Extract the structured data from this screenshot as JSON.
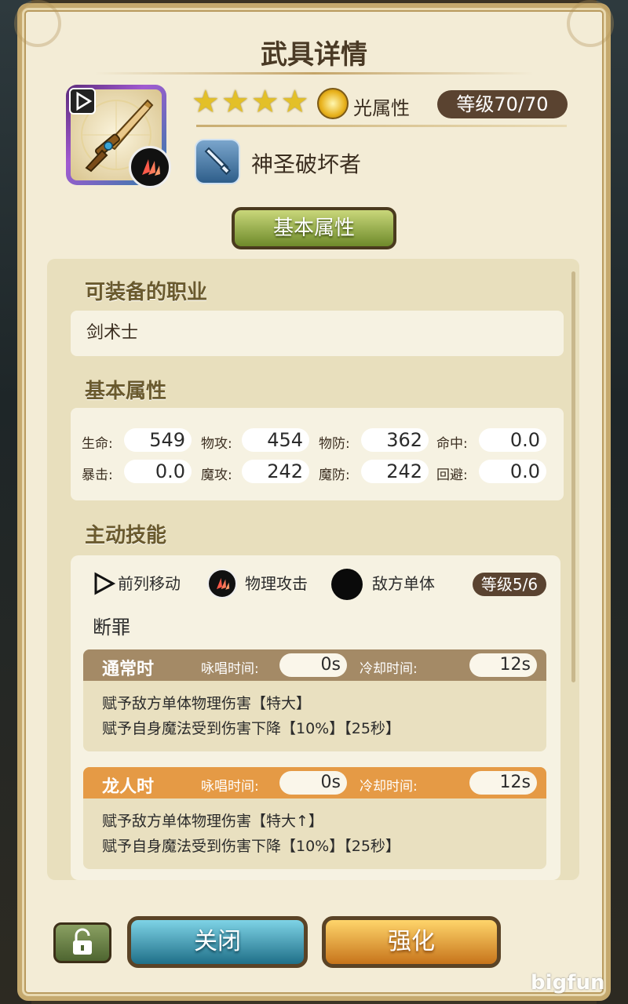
{
  "header": {
    "title": "武具详情"
  },
  "weapon": {
    "stars": [
      "★",
      "★",
      "★",
      "★"
    ],
    "attribute_label": "光属性",
    "level": "等级70/70",
    "name": "神圣破坏者"
  },
  "tabs": {
    "basic_label": "基本属性"
  },
  "jobs": {
    "title": "可装备的职业",
    "value": "剑术士"
  },
  "stats": {
    "title": "基本属性",
    "row1": [
      {
        "label": "生命:",
        "value": "549"
      },
      {
        "label": "物攻:",
        "value": "454"
      },
      {
        "label": "物防:",
        "value": "362"
      },
      {
        "label": "命中:",
        "value": "0.0"
      }
    ],
    "row2": [
      {
        "label": "暴击:",
        "value": "0.0"
      },
      {
        "label": "魔攻:",
        "value": "242"
      },
      {
        "label": "魔防:",
        "value": "242"
      },
      {
        "label": "回避:",
        "value": "0.0"
      }
    ]
  },
  "skill": {
    "title": "主动技能",
    "tags": [
      "前列移动",
      "物理攻击",
      "敌方单体"
    ],
    "level": "等级5/6",
    "name": "断罪",
    "modes": [
      {
        "title": "通常时",
        "cast_label": "咏唱时间:",
        "cast_value": "0s",
        "cooldown_label": "冷却时间:",
        "cooldown_value": "12s",
        "desc1": "赋予敌方单体物理伤害【特大】",
        "desc2": "赋予自身魔法受到伤害下降【10%】【25秒】",
        "color": "#a48a66"
      },
      {
        "title": "龙人时",
        "cast_label": "咏唱时间:",
        "cast_value": "0s",
        "cooldown_label": "冷却时间:",
        "cooldown_value": "12s",
        "desc1": "赋予敌方单体物理伤害【特大↑】",
        "desc2": "赋予自身魔法受到伤害下降【10%】【25秒】",
        "color": "#e59a45"
      }
    ]
  },
  "buttons": {
    "close": "关闭",
    "upgrade": "强化"
  },
  "watermark": "bigfun",
  "icons": {
    "play": "play-icon",
    "attack": "physical-attack-icon",
    "attribute": "light-attribute-icon",
    "weapon_type": "sword-type-icon",
    "target": "single-enemy-icon",
    "lock": "unlock-icon"
  }
}
